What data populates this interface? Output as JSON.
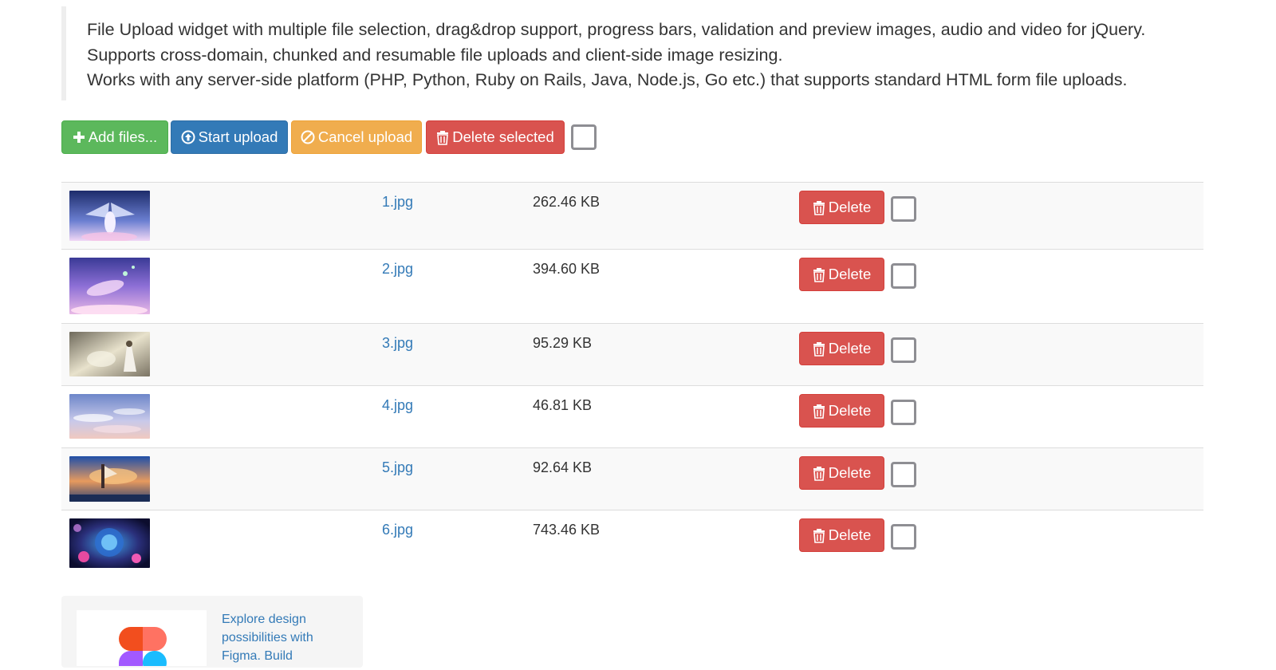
{
  "intro": {
    "lines": [
      "File Upload widget with multiple file selection, drag&drop support, progress bars, validation and preview images, audio and video for jQuery.",
      "Supports cross-domain, chunked and resumable file uploads and client-side image resizing.",
      "Works with any server-side platform (PHP, Python, Ruby on Rails, Java, Node.js, Go etc.) that supports standard HTML form file uploads."
    ]
  },
  "toolbar": {
    "add_label": "Add files...",
    "start_label": "Start upload",
    "cancel_label": "Cancel upload",
    "delete_selected_label": "Delete selected",
    "select_all_checked": false
  },
  "files": [
    {
      "name": "1.jpg",
      "size": "262.46 KB",
      "delete_label": "Delete",
      "checked": false
    },
    {
      "name": "2.jpg",
      "size": "394.60 KB",
      "delete_label": "Delete",
      "checked": false
    },
    {
      "name": "3.jpg",
      "size": "95.29 KB",
      "delete_label": "Delete",
      "checked": false
    },
    {
      "name": "4.jpg",
      "size": "46.81 KB",
      "delete_label": "Delete",
      "checked": false
    },
    {
      "name": "5.jpg",
      "size": "92.64 KB",
      "delete_label": "Delete",
      "checked": false
    },
    {
      "name": "6.jpg",
      "size": "743.46 KB",
      "delete_label": "Delete",
      "checked": false
    }
  ],
  "ad": {
    "text": "Explore design possibilities with Figma. Build"
  },
  "colors": {
    "success": "#5cb85c",
    "primary": "#337ab7",
    "warning": "#f0ad4e",
    "danger": "#d9534f",
    "link": "#337ab7"
  }
}
